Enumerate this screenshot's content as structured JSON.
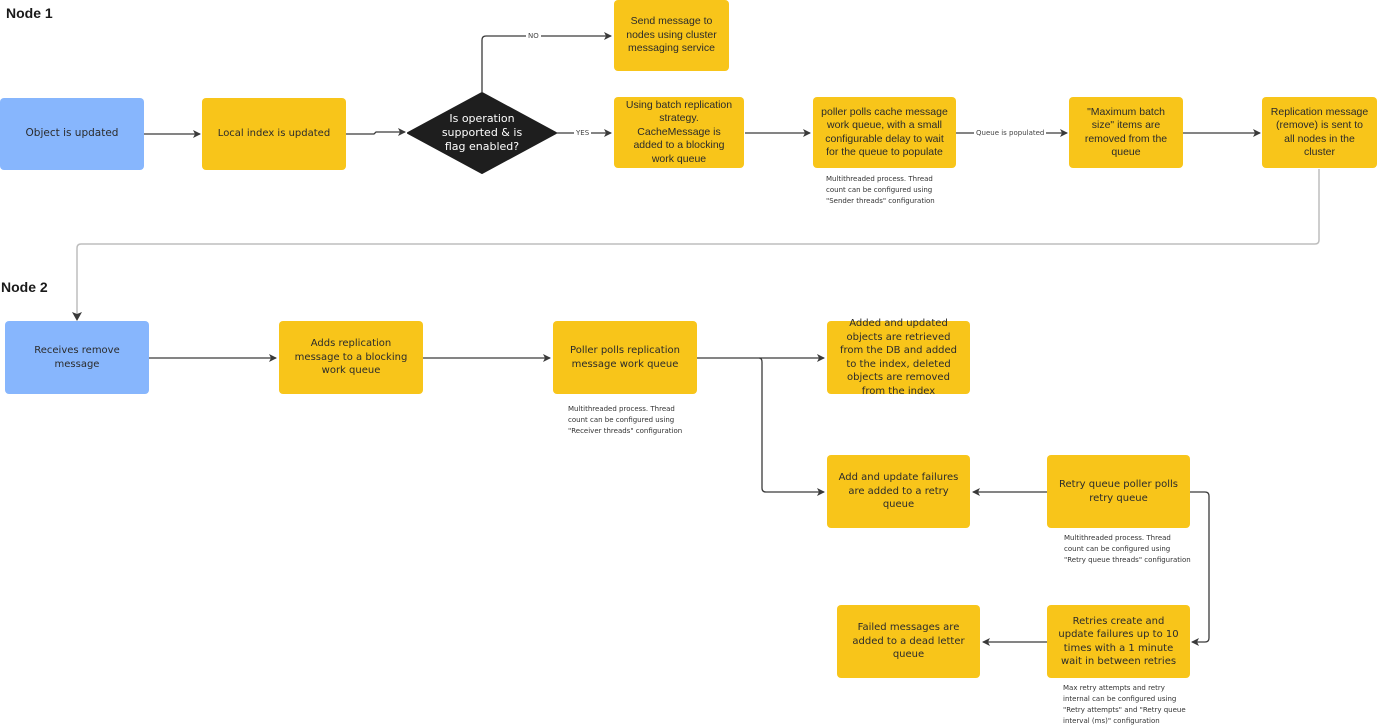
{
  "sections": {
    "node1_title": "Node 1",
    "node2_title": "Node 2"
  },
  "colors": {
    "start_box": "#87b6fd",
    "process_box": "#f8c51a",
    "decision": "#1e1e1e",
    "connector": "#3a3a3a",
    "cross_node_connector": "#bdbdbd"
  },
  "node1": {
    "object_updated": "Object is updated",
    "local_index": "Local index is updated",
    "decision": "Is operation supported & is flag enabled?",
    "send_cluster": "Send message to nodes using cluster messaging service",
    "batch_strategy": "Using batch replication strategy. CacheMessage is added to a blocking work queue",
    "poller": "poller polls cache message work queue, with a small configurable delay to wait for the queue to populate",
    "poller_note": [
      "Multithreaded process. Thread",
      "count can be configured using",
      "\"Sender threads\" configuration"
    ],
    "max_batch": "\"Maximum batch size\" items are removed from the queue",
    "replication_sent": "Replication message (remove) is sent to all nodes in the cluster"
  },
  "edge_labels": {
    "no": "NO",
    "yes": "YES",
    "queue_populated": "Queue is populated"
  },
  "node2": {
    "receives": "Receives remove message",
    "adds_replication": "Adds replication message to a blocking work queue",
    "poller": "Poller polls replication message work queue",
    "poller_note": [
      "Multithreaded process. Thread",
      "count can be configured using",
      "\"Receiver threads\" configuration"
    ],
    "added_updated": "Added and updated objects are retrieved from the DB and added to the index, deleted objects are removed from the index",
    "failures_retry": "Add and update failures are added to a retry queue",
    "retry_poller": "Retry queue poller polls retry queue",
    "retry_poller_note": [
      "Multithreaded process. Thread",
      "count can be configured using",
      "\"Retry queue threads\" configuration"
    ],
    "retries": "Retries create and update failures up to 10 times with a 1 minute wait in between retries",
    "retries_note": [
      "Max retry attempts and retry",
      "internal can be configured using",
      "\"Retry attempts\" and \"Retry queue",
      "interval (ms)\" configuration"
    ],
    "dead_letter": "Failed messages are added to a dead letter queue"
  }
}
